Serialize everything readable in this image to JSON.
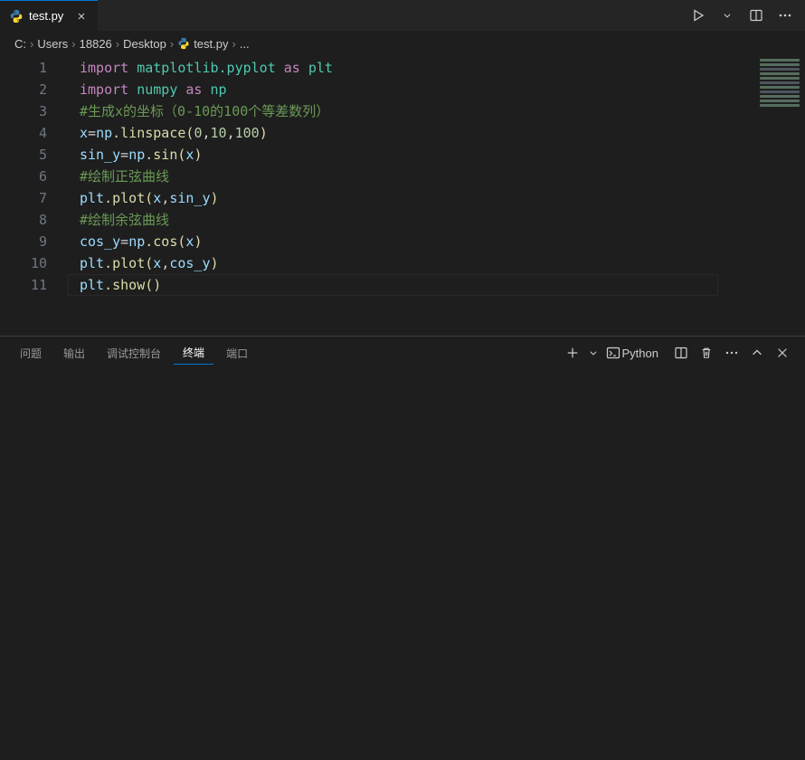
{
  "tab": {
    "filename": "test.py",
    "close_glyph": "✕"
  },
  "breadcrumbs": {
    "parts": [
      "C:",
      "Users",
      "18826",
      "Desktop",
      "test.py",
      "..."
    ],
    "chevron": "›"
  },
  "editor": {
    "line_numbers": [
      "1",
      "2",
      "3",
      "4",
      "5",
      "6",
      "7",
      "8",
      "9",
      "10",
      "11"
    ]
  },
  "code": {
    "l1": {
      "a": "import",
      "b": " matplotlib.pyplot ",
      "c": "as",
      "d": " plt"
    },
    "l2": {
      "a": "import",
      "b": " numpy ",
      "c": "as",
      "d": " np"
    },
    "l3": "#生成x的坐标（0-10的100个等差数列）",
    "l4": {
      "a": "x",
      "b": "=",
      "c": "np",
      "d": ".linspace(",
      "e": "0",
      "f": ",",
      "g": "10",
      "h": ",",
      "i": "100",
      "j": ")"
    },
    "l5": {
      "a": "sin_y",
      "b": "=",
      "c": "np",
      "d": ".sin(",
      "e": "x",
      "f": ")"
    },
    "l6": "#绘制正弦曲线",
    "l7": {
      "a": "plt",
      "b": ".plot(",
      "c": "x",
      "d": ",",
      "e": "sin_y",
      "f": ")"
    },
    "l8": "#绘制余弦曲线",
    "l9": {
      "a": "cos_y",
      "b": "=",
      "c": "np",
      "d": ".cos(",
      "e": "x",
      "f": ")"
    },
    "l10": {
      "a": "plt",
      "b": ".plot(",
      "c": "x",
      "d": ",",
      "e": "cos_y",
      "f": ")"
    },
    "l11": {
      "a": "plt",
      "b": ".show()"
    }
  },
  "panel": {
    "tabs": {
      "problems": "问题",
      "output": "输出",
      "debug": "调试控制台",
      "terminal": "终端",
      "ports": "端口"
    },
    "launcher": "Python"
  }
}
